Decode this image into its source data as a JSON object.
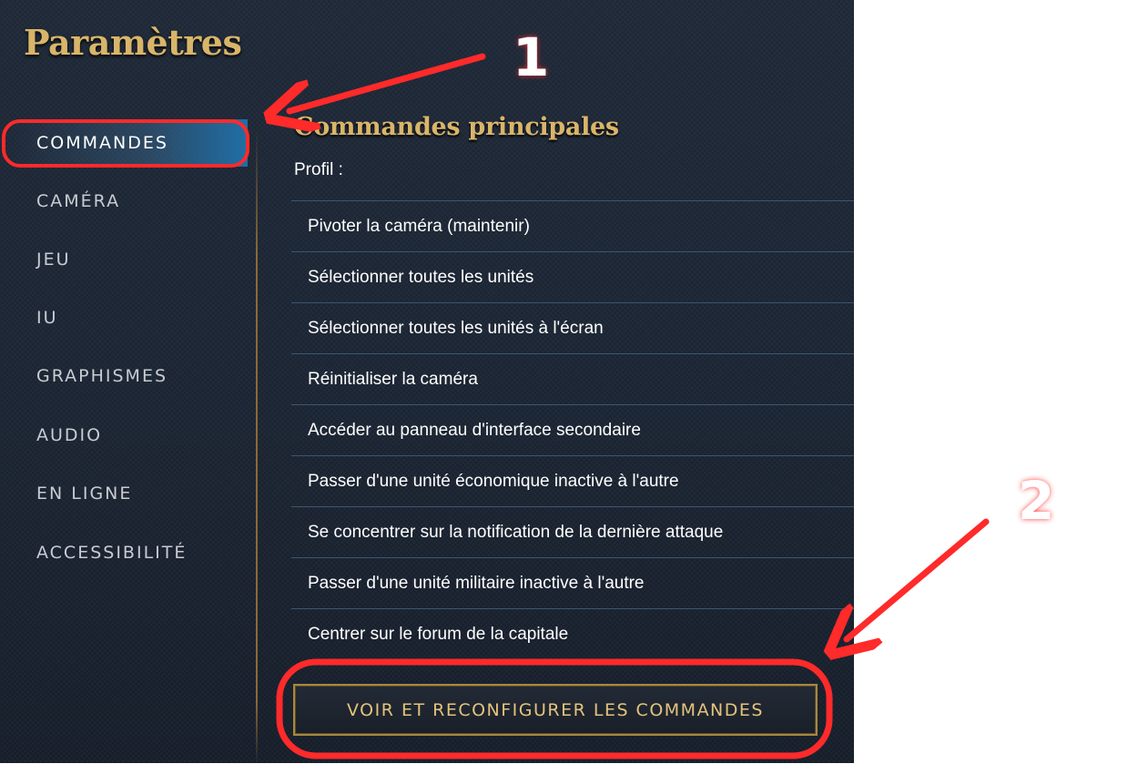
{
  "window": {
    "title": "Paramètres"
  },
  "sidebar": {
    "items": [
      {
        "label": "COMMANDES",
        "active": true
      },
      {
        "label": "CAMÉRA"
      },
      {
        "label": "JEU"
      },
      {
        "label": "IU"
      },
      {
        "label": "GRAPHISMES"
      },
      {
        "label": "AUDIO"
      },
      {
        "label": "EN LIGNE"
      },
      {
        "label": "ACCESSIBILITÉ"
      }
    ]
  },
  "main": {
    "section_title": "Commandes principales",
    "profile_label": "Profil :",
    "commands": [
      "Pivoter la caméra (maintenir)",
      "Sélectionner toutes les unités",
      "Sélectionner toutes les unités à l'écran",
      "Réinitialiser la caméra",
      "Accéder au panneau d'interface secondaire",
      "Passer d'une unité économique inactive à l'autre",
      "Se concentrer sur la notification de la dernière attaque",
      "Passer d'une unité militaire inactive à l'autre",
      "Centrer sur le forum de la capitale"
    ],
    "reconfigure_button": "VOIR ET RECONFIGURER LES COMMANDES"
  },
  "annotations": {
    "step1": "1",
    "step2": "2",
    "color": "#ff2a2a"
  },
  "colors": {
    "gold": "#d9b56a",
    "active_blue": "#1f6fa6",
    "panel_bg": "#1b2432"
  }
}
